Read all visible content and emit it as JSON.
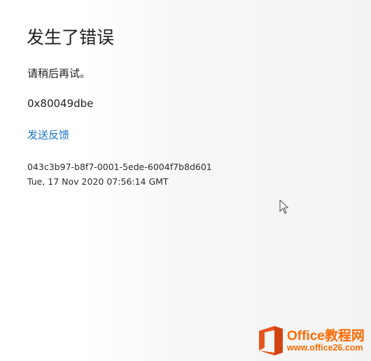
{
  "error": {
    "title": "发生了错误",
    "message": "请稍后再试。",
    "code": "0x80049dbe",
    "feedback_link": "发送反馈",
    "correlation_id": "043c3b97-b8f7-0001-5ede-6004f7b8d601",
    "timestamp": "Tue, 17 Nov 2020 07:56:14 GMT"
  },
  "colors": {
    "link": "#1a73c8",
    "text": "#1f1f1f",
    "watermark": "#ff6a00"
  },
  "watermark": {
    "title": "Office教程网",
    "url": "www.office26.com"
  },
  "icons": {
    "cursor": "mouse-pointer-icon",
    "logo": "office-logo-icon"
  }
}
